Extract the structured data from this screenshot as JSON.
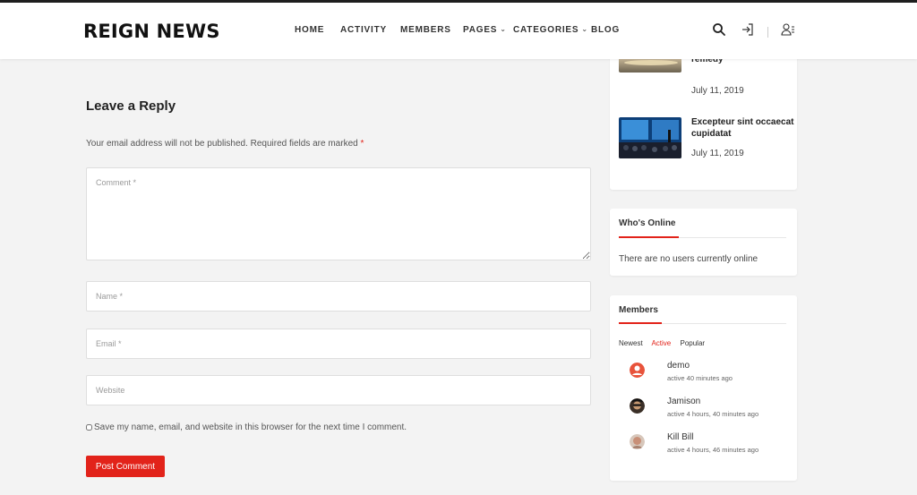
{
  "header": {
    "logo": "REIGN NEWS",
    "nav": [
      {
        "label": "HOME"
      },
      {
        "label": "ACTIVITY"
      },
      {
        "label": "MEMBERS"
      },
      {
        "label": "PAGES"
      },
      {
        "label": "CATEGORIES"
      },
      {
        "label": "BLOG"
      }
    ],
    "icons": [
      "search-icon",
      "login-icon",
      "user-register-icon"
    ]
  },
  "reply": {
    "title": "Leave a Reply",
    "note": "Your email address will not be published. Required fields are marked",
    "required_mark": "*",
    "comment_placeholder": "Comment *",
    "name_placeholder": "Name *",
    "email_placeholder": "Email *",
    "website_placeholder": "Website",
    "save_label": "Save my name, email, and website in this browser for the next time I comment.",
    "submit_label": "Post Comment"
  },
  "sidebar": {
    "recent_posts": [
      {
        "title": "Music is the best remedy",
        "date": "July 11, 2019"
      },
      {
        "title": "Excepteur sint occaecat cupidatat",
        "date": "July 11, 2019"
      }
    ],
    "whos_online": {
      "title": "Who's Online",
      "text": "There are no users currently online"
    },
    "members": {
      "title": "Members",
      "tabs": [
        {
          "label": "Newest",
          "active": false
        },
        {
          "label": "Active",
          "active": true
        },
        {
          "label": "Popular",
          "active": false
        }
      ],
      "list": [
        {
          "name": "demo",
          "active": "active 40 minutes ago"
        },
        {
          "name": "Jamison",
          "active": "active 4 hours, 40 minutes ago"
        },
        {
          "name": "Kill Bill",
          "active": "active 4 hours, 46 minutes ago"
        }
      ]
    }
  },
  "colors": {
    "accent": "#e2231a",
    "background": "#f3f3f3",
    "topbar": "#1e1e1e"
  }
}
